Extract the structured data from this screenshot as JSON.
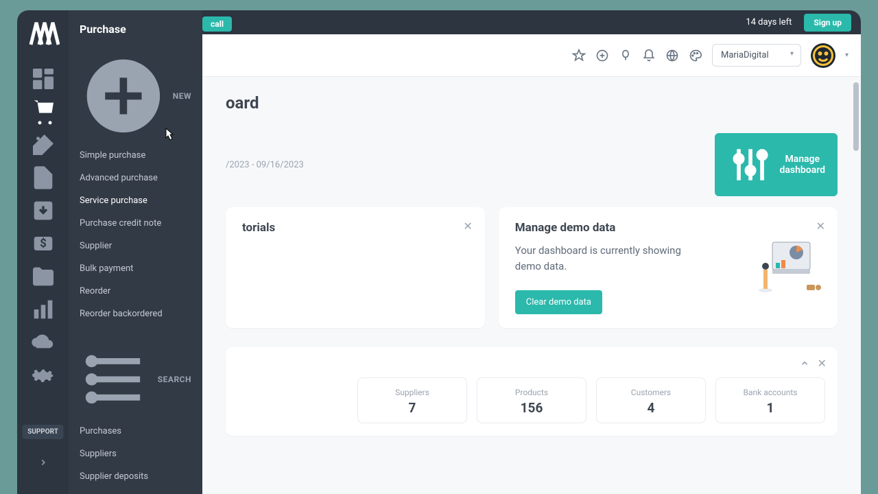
{
  "promo": {
    "pill": "call",
    "days_left": "14 days left",
    "signup": "Sign up"
  },
  "header": {
    "org": "MariaDigital"
  },
  "page": {
    "title": "Dashboard",
    "title_suffix": "oard"
  },
  "flyout": {
    "title": "Purchase",
    "section_new": "NEW",
    "section_search": "SEARCH",
    "new_items": [
      "Simple purchase",
      "Advanced purchase",
      "Service purchase",
      "Purchase credit note",
      "Supplier",
      "Bulk payment",
      "Reorder",
      "Reorder backordered"
    ],
    "search_items": [
      "Purchases",
      "Suppliers",
      "Supplier deposits"
    ]
  },
  "toolbar": {
    "date_range": "/2023 - 09/16/2023",
    "manage": "Manage dashboard"
  },
  "cards": {
    "tutorials": {
      "title": "torials"
    },
    "demo": {
      "title": "Manage demo data",
      "text": "Your dashboard is currently showing demo data.",
      "button": "Clear demo data"
    }
  },
  "stats": [
    {
      "label": "Suppliers",
      "value": "7"
    },
    {
      "label": "Products",
      "value": "156"
    },
    {
      "label": "Customers",
      "value": "4"
    },
    {
      "label": "Bank accounts",
      "value": "1"
    }
  ],
  "support": "SUPPORT"
}
